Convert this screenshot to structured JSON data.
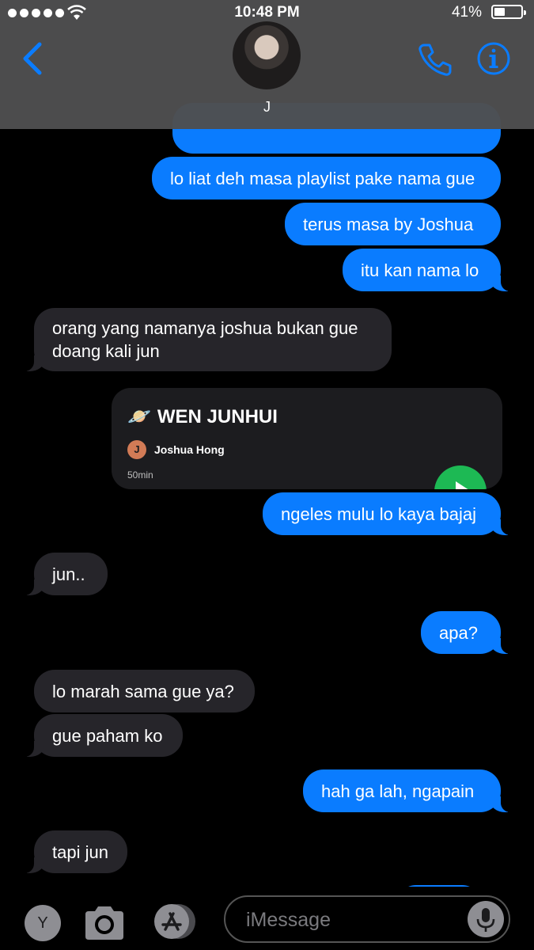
{
  "status_bar": {
    "time": "10:48 PM",
    "battery": "41%",
    "battery_level": 0.41
  },
  "header": {
    "contact_name": "J",
    "back_icon": "chevron-left-icon",
    "call_icon": "phone-icon",
    "info_icon": "info-icon"
  },
  "messages": [
    {
      "dir": "out",
      "text": "lo liat deh masa playlist pake nama gue"
    },
    {
      "dir": "out",
      "text": "terus masa by Joshua"
    },
    {
      "dir": "out",
      "text": "itu kan nama lo"
    },
    {
      "dir": "in",
      "text": "orang yang namanya joshua bukan gue doang kali jun"
    },
    {
      "dir": "out",
      "text": "ngeles mulu lo kaya bajaj"
    },
    {
      "dir": "in",
      "text": "jun.."
    },
    {
      "dir": "out",
      "text": "apa?"
    },
    {
      "dir": "in",
      "text": "lo marah sama gue ya?"
    },
    {
      "dir": "in",
      "text": "gue paham ko"
    },
    {
      "dir": "out",
      "text": "hah ga lah, ngapain"
    },
    {
      "dir": "in",
      "text": "tapi jun"
    }
  ],
  "link_card": {
    "emoji": "🪐",
    "title": "WEN JUNHUI",
    "artist_initial": "J",
    "artist": "Joshua Hong",
    "duration": "50min"
  },
  "bottom_bar": {
    "app_initial": "Y",
    "placeholder": "iMessage",
    "camera_icon": "camera-icon",
    "appstore_icon": "app-store-icon",
    "mic_icon": "microphone-icon"
  },
  "colors": {
    "outgoing": "#0a7cff",
    "incoming": "#26252a",
    "header": "#4e4e50",
    "accent": "#0a7cff"
  }
}
